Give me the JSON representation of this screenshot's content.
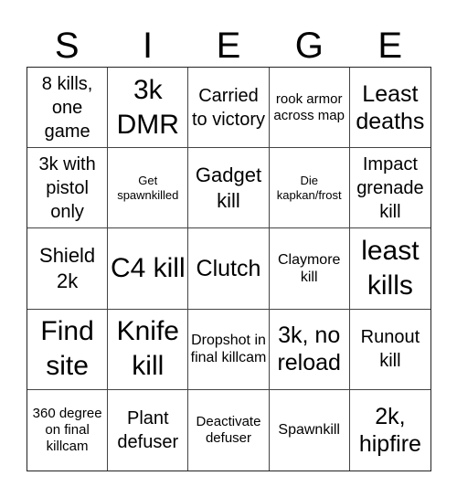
{
  "header": {
    "letters": [
      "S",
      "I",
      "E",
      "G",
      "E"
    ]
  },
  "cells": [
    "8 kills, one game",
    "3k DMR",
    "Carried to victory",
    "rook armor across map",
    "Least deaths",
    "3k with pistol only",
    "Get spawnkilled",
    "Gadget kill",
    "Die kapkan/frost",
    "Impact grenade kill",
    "Shield 2k",
    "C4 kill",
    "Clutch",
    "Claymore kill",
    "least kills",
    "Find site",
    "Knife kill",
    "Dropshot in final killcam",
    "3k, no reload",
    "Runout kill",
    "360 degree on final killcam",
    "Plant defuser",
    "Deactivate defuser",
    "Spawnkill",
    "2k, hipfire"
  ]
}
